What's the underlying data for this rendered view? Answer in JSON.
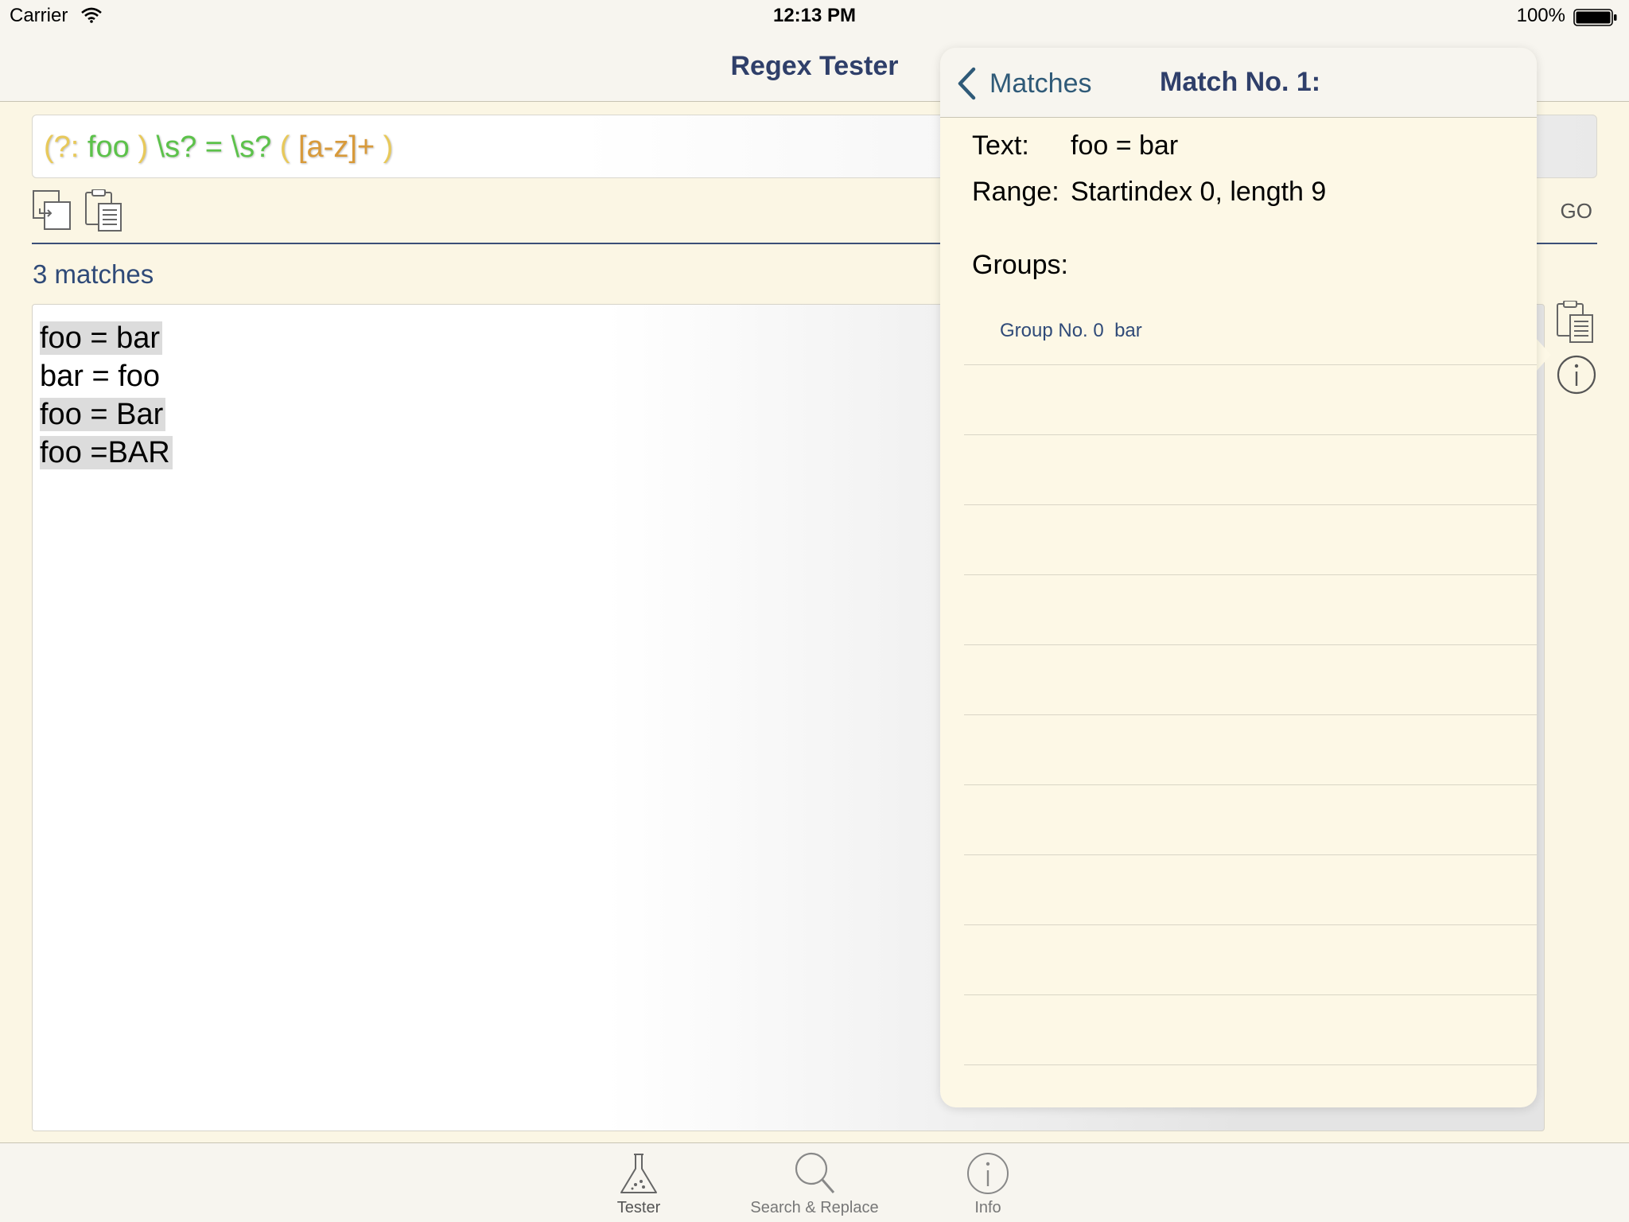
{
  "status_bar": {
    "carrier": "Carrier",
    "time": "12:13 PM",
    "battery": "100%"
  },
  "nav": {
    "title": "Regex Tester"
  },
  "pattern": {
    "tokens": [
      {
        "text": "(?:",
        "color": "#e8c95a"
      },
      {
        "text": " foo ",
        "color": "#5cc24a"
      },
      {
        "text": ")",
        "color": "#e8c95a"
      },
      {
        "text": " \\s? = \\s? ",
        "color": "#5cc24a"
      },
      {
        "text": "(",
        "color": "#e8c95a"
      },
      {
        "text": " [a-z]+ ",
        "color": "#d89a3a"
      },
      {
        "text": ")",
        "color": "#e8c95a"
      }
    ]
  },
  "toolbar": {
    "go_label": "GO"
  },
  "results": {
    "match_count": "3 matches"
  },
  "text_area": {
    "lines": [
      "foo = bar",
      "bar = foo",
      "foo = Bar",
      "foo =BAR"
    ]
  },
  "popover": {
    "back_label": "Matches",
    "title": "Match No. 1:",
    "text_label": "Text:",
    "text_value": "foo = bar",
    "range_label": "Range:",
    "range_value": "Startindex 0, length 9",
    "groups_label": "Groups:",
    "groups": [
      {
        "label": "Group No. 0",
        "value": "bar"
      }
    ]
  },
  "tabs": [
    {
      "label": "Tester",
      "icon": "flask-icon"
    },
    {
      "label": "Search & Replace",
      "icon": "search-icon"
    },
    {
      "label": "Info",
      "icon": "info-icon"
    }
  ],
  "colors": {
    "accent": "#2f3f6a",
    "background": "#fbf6e4"
  }
}
